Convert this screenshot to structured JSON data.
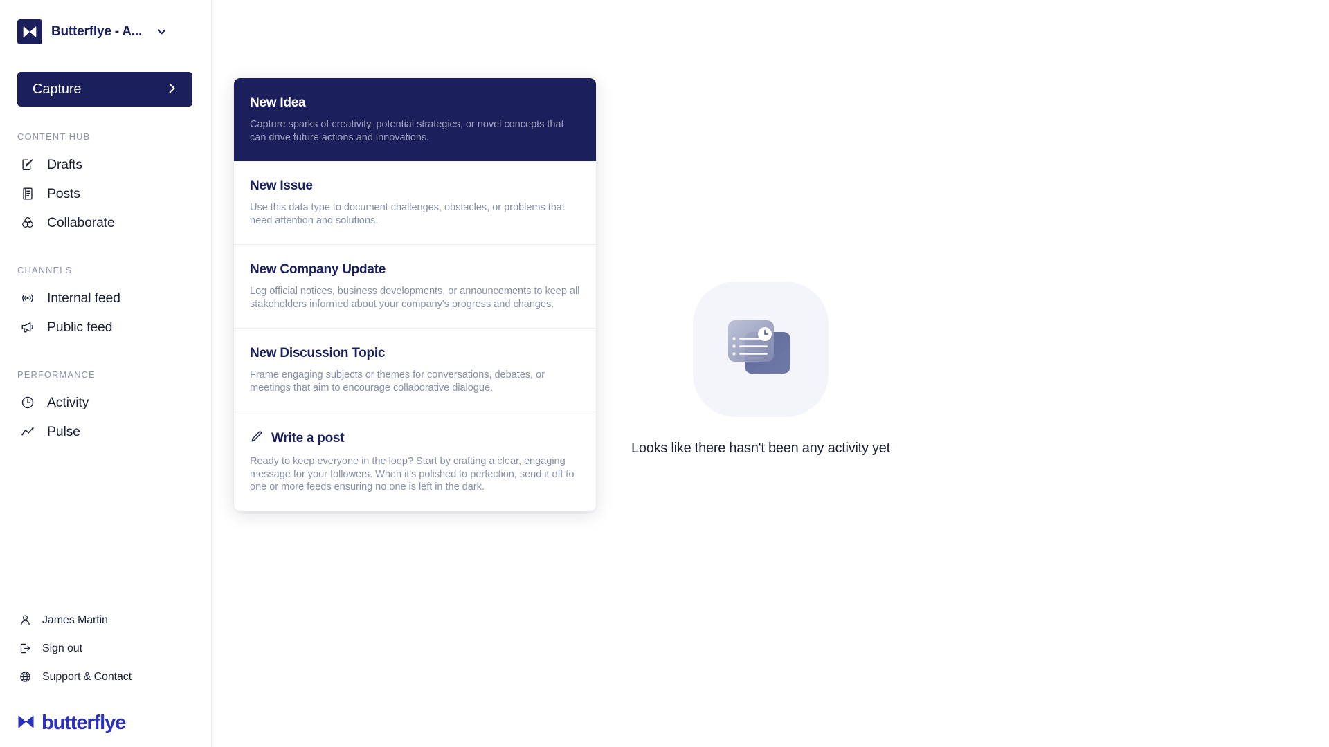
{
  "sidebar": {
    "brand": {
      "name": "Butterflye - A...",
      "logo_icon": "butterflye-mark-icon",
      "caret_icon": "chevron-down-icon"
    },
    "capture_button": {
      "label": "Capture",
      "icon": "chevron-right-icon"
    },
    "sections": [
      {
        "heading": "CONTENT HUB",
        "items": [
          {
            "label": "Drafts",
            "icon": "edit-square-icon"
          },
          {
            "label": "Posts",
            "icon": "document-lines-icon"
          },
          {
            "label": "Collaborate",
            "icon": "venn-circles-icon"
          }
        ]
      },
      {
        "heading": "CHANNELS",
        "items": [
          {
            "label": "Internal feed",
            "icon": "broadcast-signal-icon"
          },
          {
            "label": "Public feed",
            "icon": "megaphone-icon"
          }
        ]
      },
      {
        "heading": "PERFORMANCE",
        "items": [
          {
            "label": "Activity",
            "icon": "clock-icon"
          },
          {
            "label": "Pulse",
            "icon": "line-chart-icon"
          }
        ]
      }
    ],
    "footer": {
      "items": [
        {
          "label": "James Martin",
          "icon": "user-icon"
        },
        {
          "label": "Sign out",
          "icon": "logout-icon"
        },
        {
          "label": "Support & Contact",
          "icon": "globe-icon"
        }
      ],
      "wordmark": {
        "text": "butterflye",
        "icon": "butterflye-mark-icon"
      }
    }
  },
  "capture_panel": {
    "items": [
      {
        "title": "New Idea",
        "description": "Capture sparks of creativity, potential strategies, or novel concepts that can drive future actions and innovations.",
        "active": true
      },
      {
        "title": "New Issue",
        "description": "Use this data type to document challenges, obstacles, or problems that need attention and solutions.",
        "active": false
      },
      {
        "title": "New Company Update",
        "description": "Log official notices, business developments, or announcements to keep all stakeholders informed about your company's progress and changes.",
        "active": false
      },
      {
        "title": "New Discussion Topic",
        "description": "Frame engaging subjects or themes for conversations, debates, or meetings that aim to encourage collaborative dialogue.",
        "active": false
      },
      {
        "title": "Write a post",
        "description": "Ready to keep everyone in the loop? Start by crafting a clear, engaging message for your followers. When it's polished to perfection, send it off to one or more feeds ensuring no one is left in the dark.",
        "active": false,
        "icon": "pencil-icon"
      }
    ]
  },
  "empty_state": {
    "message": "Looks like there hasn't been any activity yet",
    "illustration_icon": "activity-cards-clock-illustration"
  },
  "colors": {
    "brand_navy": "#1b1f5c",
    "brand_blue": "#2b31b8",
    "muted_text": "#8890a6",
    "heading_muted": "#8d93a8",
    "border": "#e9eaee",
    "illustration_bg": "#f4f5fa"
  }
}
